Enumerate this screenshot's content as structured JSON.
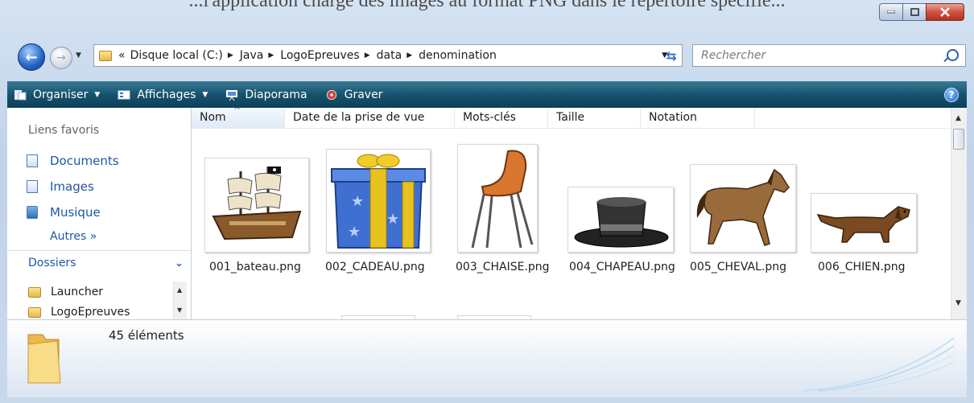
{
  "background_text": "...l'application charge des images au format PNG dans le répertoire spécifié...",
  "address": {
    "breadcrumbs": [
      "«",
      "Disque local (C:)",
      "Java",
      "LogoEpreuves",
      "data",
      "denomination"
    ]
  },
  "search": {
    "placeholder": "Rechercher"
  },
  "toolbar": {
    "items": [
      {
        "label": "Organiser",
        "icon": "organize-icon",
        "has_menu": true
      },
      {
        "label": "Affichages",
        "icon": "views-icon",
        "has_menu": true
      },
      {
        "label": "Diaporama",
        "icon": "slideshow-icon",
        "has_menu": false
      },
      {
        "label": "Graver",
        "icon": "burn-disc-icon",
        "has_menu": false
      }
    ]
  },
  "nav": {
    "favorites_header": "Liens favoris",
    "favorites": [
      {
        "label": "Documents",
        "icon": "documents-icon"
      },
      {
        "label": "Images",
        "icon": "images-icon"
      },
      {
        "label": "Musique",
        "icon": "music-icon"
      }
    ],
    "more": "Autres »",
    "folders_header": "Dossiers",
    "tree": [
      "Launcher",
      "LogoEpreuves"
    ]
  },
  "columns": [
    "Nom",
    "Date de la prise de vue",
    "Mots-clés",
    "Taille",
    "Notation"
  ],
  "files": [
    {
      "name": "001_bateau.png",
      "icon": "pirate-ship-icon"
    },
    {
      "name": "002_CADEAU.png",
      "icon": "gift-box-icon"
    },
    {
      "name": "003_CHAISE.png",
      "icon": "chair-icon"
    },
    {
      "name": "004_CHAPEAU.png",
      "icon": "top-hat-icon"
    },
    {
      "name": "005_CHEVAL.png",
      "icon": "horse-icon"
    },
    {
      "name": "006_CHIEN.png",
      "icon": "dachshund-icon"
    }
  ],
  "details": {
    "count": "45 éléments"
  },
  "colors": {
    "toolbar": "#16536e",
    "link": "#1e56a5",
    "close": "#d1503e"
  }
}
